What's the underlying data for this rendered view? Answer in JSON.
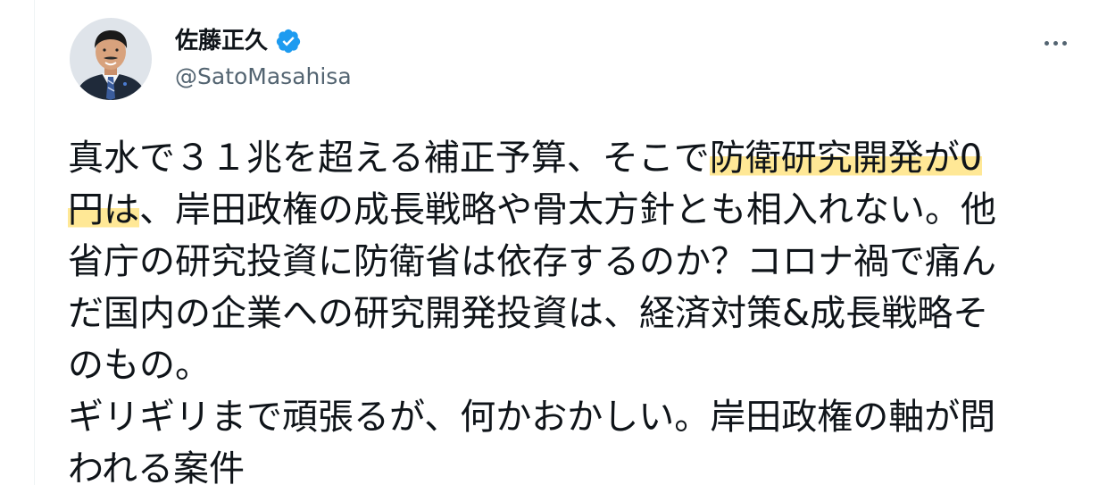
{
  "author": {
    "display_name": "佐藤正久",
    "handle": "@SatoMasahisa",
    "verified": true,
    "avatar_icon": "user-portrait-avatar"
  },
  "menu": {
    "icon": "more-horizontal-icon"
  },
  "tweet": {
    "lines": [
      {
        "a": "真水で３１兆を超える補正予算、そこで",
        "hl": "防衛研究開発が0"
      },
      {
        "hl": "円は",
        "b": "、岸田政権の成長戦略や骨太方針とも相入れない。他"
      },
      {
        "a": "省庁の研究投資に防衛省は依存するのか？コロナ禍で痛ん"
      },
      {
        "a": "だ国内の企業への研究開発投資は、経済対策&成長戦略そ"
      },
      {
        "a": "のもの。"
      },
      {
        "a": "ギリギリまで頑張るが、何かおかしい。岸田政権の軸が問"
      },
      {
        "a": "われる案件"
      }
    ]
  },
  "colors": {
    "text_primary": "#0f1419",
    "text_secondary": "#536471",
    "verified_blue": "#1d9bf0",
    "highlight": "#ffd640"
  }
}
